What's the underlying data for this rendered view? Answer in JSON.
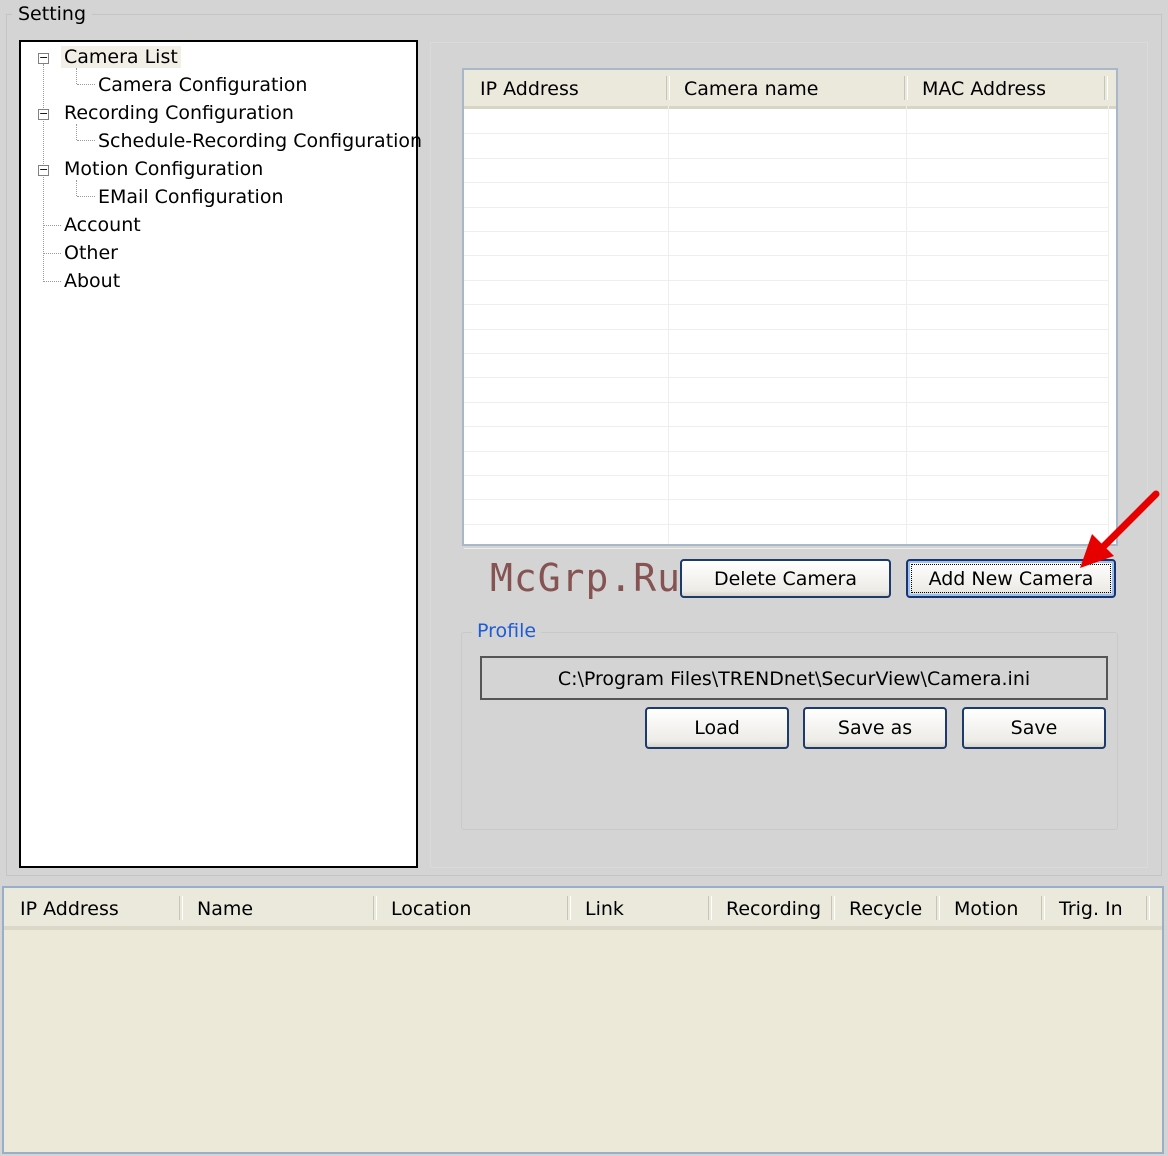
{
  "setting": {
    "title": "Setting"
  },
  "tree": {
    "items": [
      {
        "label": "Camera List",
        "expander": "−"
      },
      {
        "label": "Camera Configuration"
      },
      {
        "label": "Recording Configuration",
        "expander": "−"
      },
      {
        "label": "Schedule-Recording Configuration"
      },
      {
        "label": "Motion Configuration",
        "expander": "−"
      },
      {
        "label": "EMail Configuration"
      },
      {
        "label": "Account"
      },
      {
        "label": "Other"
      },
      {
        "label": "About"
      }
    ]
  },
  "camera_table": {
    "columns": [
      "IP Address",
      "Camera name",
      "MAC Address"
    ],
    "rows": []
  },
  "buttons": {
    "delete_camera": "Delete Camera",
    "add_new_camera": "Add New Camera",
    "load": "Load",
    "save_as": "Save as",
    "save": "Save"
  },
  "watermark": "McGrp.Ru",
  "profile": {
    "title": "Profile",
    "path": "C:\\Program Files\\TRENDnet\\SecurView\\Camera.ini"
  },
  "bottom_list": {
    "columns": [
      "IP Address",
      "Name",
      "Location",
      "Link",
      "Recording",
      "Recycle",
      "Motion",
      "Trig. In"
    ],
    "rows": []
  },
  "colors": {
    "background": "#d4d4d4",
    "profile_title": "#1e5bd6",
    "arrow": "#e60000",
    "list_background": "#ece9d8"
  }
}
